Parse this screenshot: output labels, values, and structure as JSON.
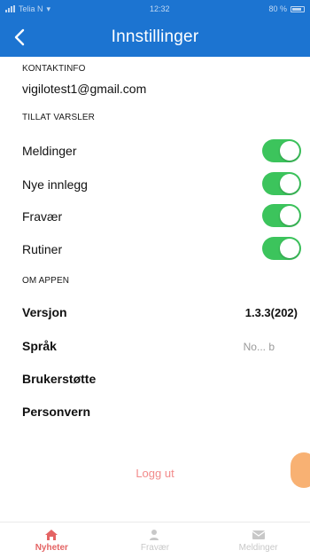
{
  "status_bar": {
    "carrier": "Telia N",
    "time": "12:32",
    "battery": "80 %"
  },
  "header": {
    "title": "Innstillinger"
  },
  "contact": {
    "section_label": "KONTAKTINFO",
    "email": "vigilotest1@gmail.com"
  },
  "notifications": {
    "section_label": "TILLAT VARSLER",
    "items": [
      {
        "label": "Meldinger",
        "enabled": true
      },
      {
        "label": "Nye innlegg",
        "enabled": true
      },
      {
        "label": "Fravær",
        "enabled": true
      },
      {
        "label": "Rutiner",
        "enabled": true
      }
    ]
  },
  "about": {
    "section_label": "OM APPEN",
    "version_label": "Versjon",
    "version_value": "1.3.3(202)",
    "language_label": "Språk",
    "language_value": "No... b",
    "support_label": "Brukerstøtte",
    "privacy_label": "Personvern"
  },
  "logout_label": "Logg ut",
  "tabs": [
    {
      "label": "Nyheter",
      "icon": "home-icon",
      "active": true
    },
    {
      "label": "Fravær",
      "icon": "person-icon",
      "active": false
    },
    {
      "label": "Meldinger",
      "icon": "envelope-icon",
      "active": false
    }
  ],
  "colors": {
    "primary": "#1c74d1",
    "toggle_on": "#3cc45c",
    "active_tab": "#e46464",
    "logout": "#f28b8b"
  }
}
